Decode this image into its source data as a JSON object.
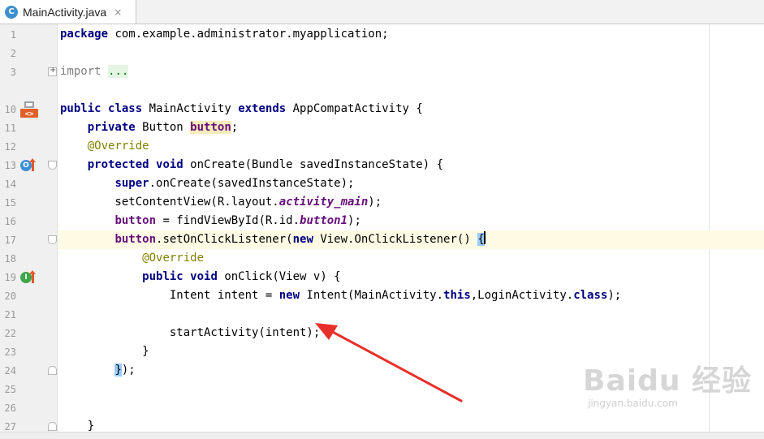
{
  "tab": {
    "icon_letter": "C",
    "title": "MainActivity.java",
    "close": "×"
  },
  "line_numbers": [
    "1",
    "2",
    "3",
    "10",
    "11",
    "12",
    "13",
    "14",
    "15",
    "16",
    "17",
    "18",
    "19",
    "20",
    "21",
    "22",
    "23",
    "24",
    "25",
    "26",
    "27"
  ],
  "code": {
    "l1": [
      "package",
      " com.example.administrator.myapplication;"
    ],
    "l3": [
      "import",
      " ",
      "..."
    ],
    "l10": [
      "public",
      " ",
      "class",
      " MainActivity ",
      "extends",
      " AppCompatActivity {"
    ],
    "l11": [
      "    ",
      "private",
      " Button ",
      "button",
      ";"
    ],
    "l12": [
      "    ",
      "@Override"
    ],
    "l13": [
      "    ",
      "protected",
      " ",
      "void",
      " onCreate(Bundle savedInstanceState) {"
    ],
    "l14": [
      "        ",
      "super",
      ".onCreate(savedInstanceState);"
    ],
    "l15": [
      "        setContentView(R.layout.",
      "activity_main",
      ");"
    ],
    "l16": [
      "        ",
      "button",
      " = findViewById(R.id.",
      "button1",
      ");"
    ],
    "l17": [
      "        ",
      "button",
      ".setOnClickListener(",
      "new",
      " View.OnClickListener() ",
      "{"
    ],
    "l18": [
      "            ",
      "@Override"
    ],
    "l19": [
      "            ",
      "public",
      " ",
      "void",
      " onClick(View v) {"
    ],
    "l20": [
      "                Intent intent = ",
      "new",
      " Intent(MainActivity.",
      "this",
      ",LoginActivity.",
      "class",
      ");"
    ],
    "l22": [
      "                startActivity(intent);"
    ],
    "l23": [
      "            }"
    ],
    "l24": [
      "        ",
      "}",
      ");"
    ],
    "l27": [
      "    }"
    ]
  },
  "gutter_icons": {
    "override_letter": "O",
    "implement_letter": "I"
  },
  "watermark": {
    "logo": "Baidu 经验",
    "url": "jingyan.baidu.com"
  },
  "colors": {
    "keyword": "#000080",
    "annotation": "#808000",
    "field": "#660e7a",
    "arrow": "#e8302a"
  }
}
